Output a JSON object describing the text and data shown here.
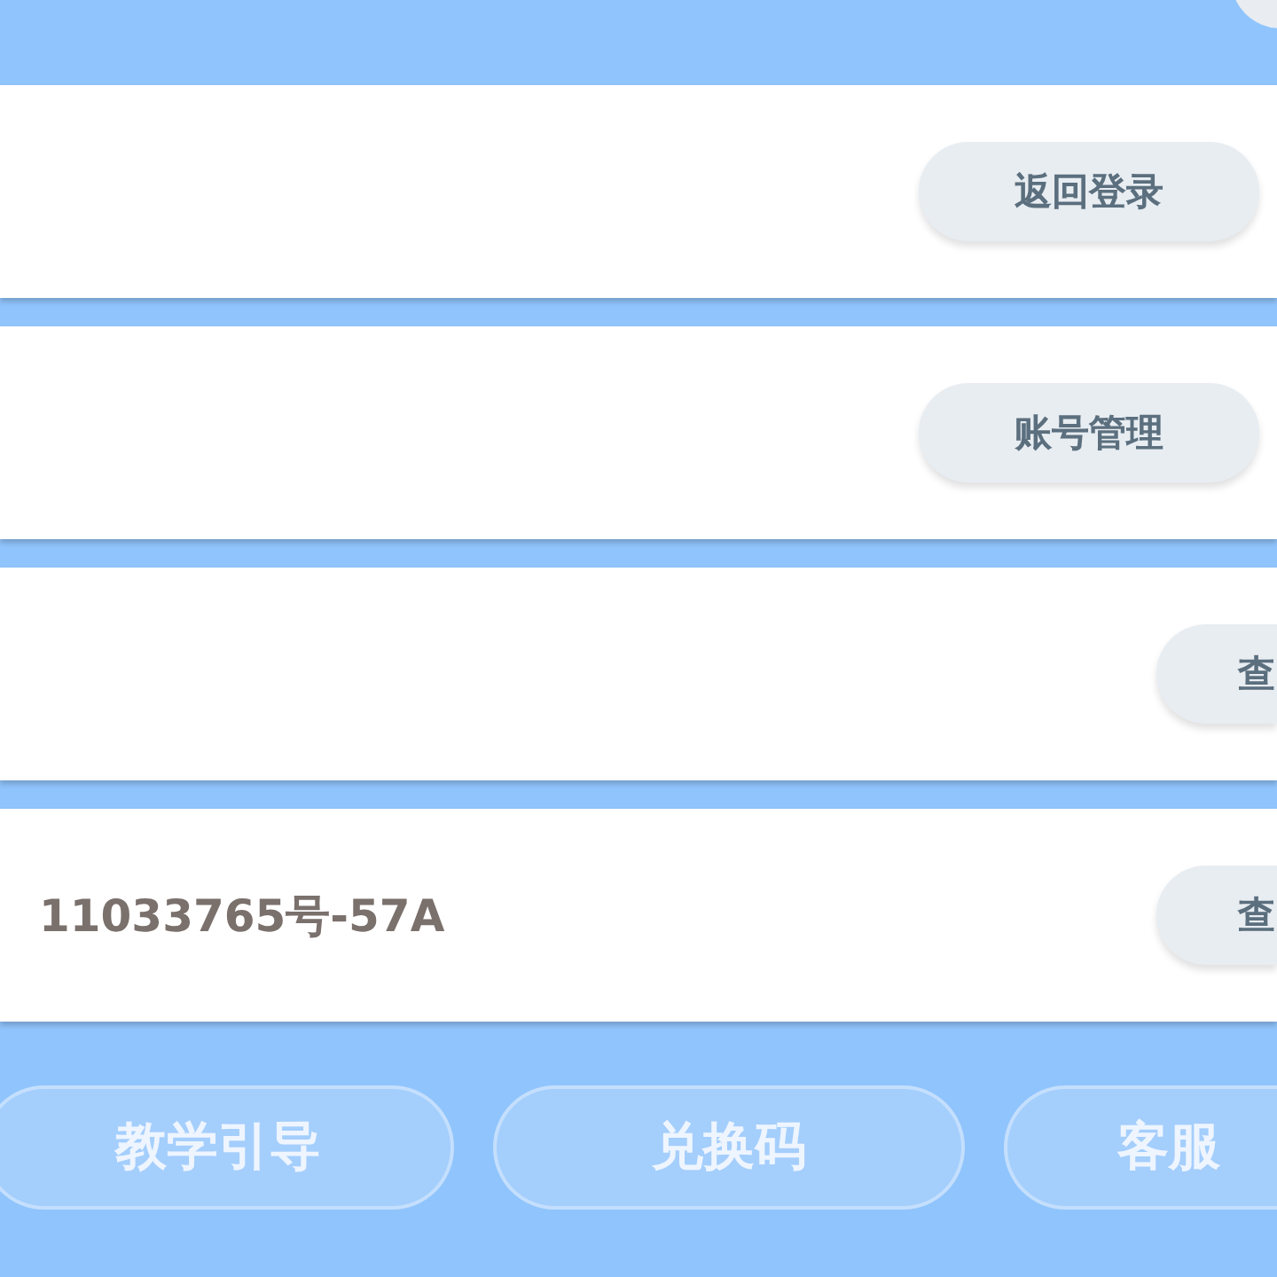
{
  "rows": [
    {
      "button": "返回登录"
    },
    {
      "button": "账号管理"
    },
    {
      "button": "查"
    },
    {
      "text": "11033765号-57A",
      "button": "查"
    }
  ],
  "bottom_buttons": [
    "教学引导",
    "兑换码",
    "客服"
  ]
}
